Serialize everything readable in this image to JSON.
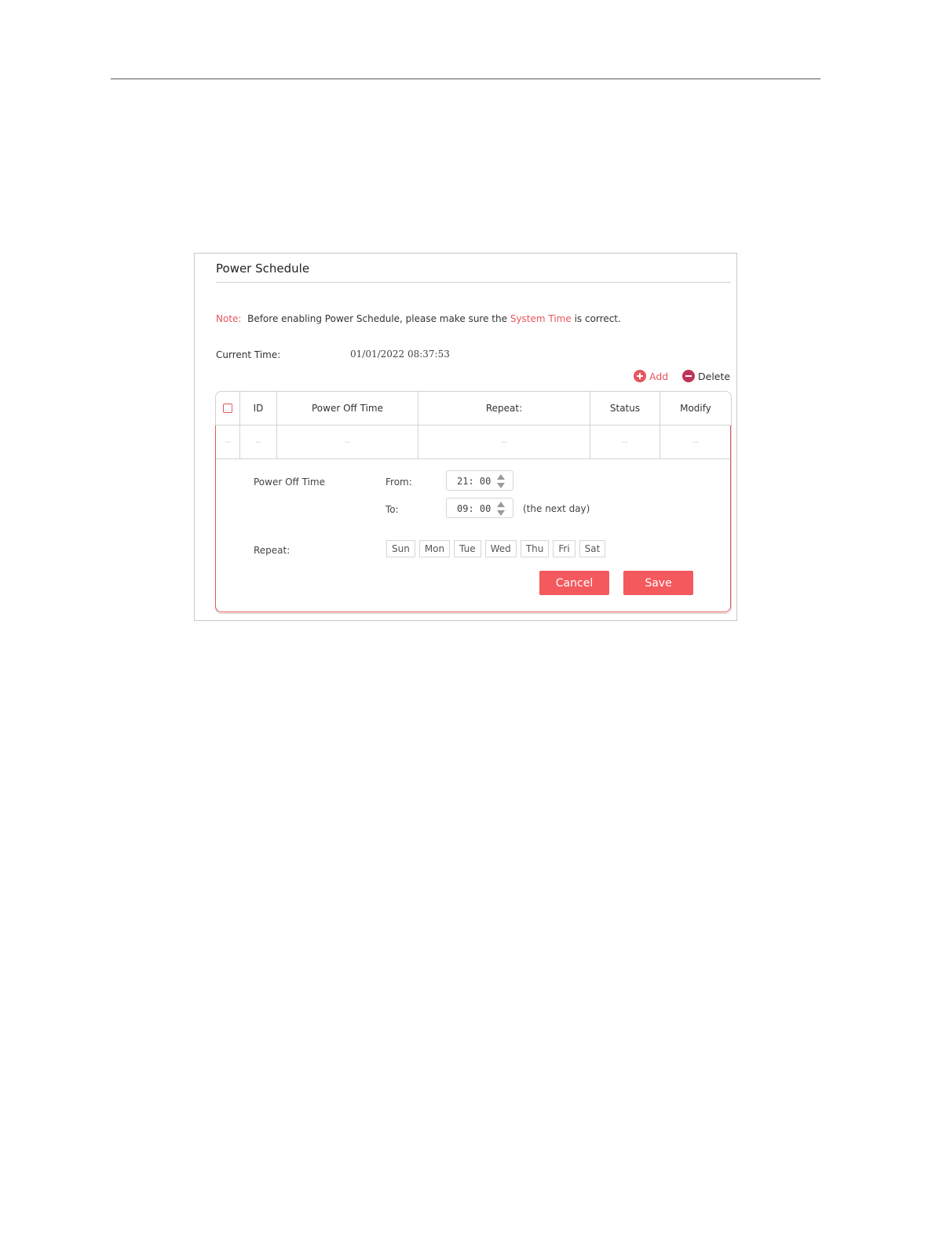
{
  "panel": {
    "title": "Power Schedule",
    "note_label": "Note:",
    "note_text_1": "Before enabling Power Schedule, please make sure the",
    "note_link": "System Time",
    "note_text_2": "is correct.",
    "current_time_label": "Current Time:",
    "current_time_value": "01/01/2022 08:37:53",
    "add_label": "Add",
    "delete_label": "Delete"
  },
  "table": {
    "headers": [
      "",
      "ID",
      "Power Off Time",
      "Repeat:",
      "Status",
      "Modify"
    ],
    "row": [
      "--",
      "--",
      "--",
      "--",
      "--",
      "--"
    ]
  },
  "form": {
    "power_off_time_label": "Power Off Time",
    "from_label": "From:",
    "from_value": "21: 00",
    "to_label": "To:",
    "to_value": "09: 00",
    "next_day_note": "(the next day)",
    "repeat_label": "Repeat:",
    "days": [
      "Sun",
      "Mon",
      "Tue",
      "Wed",
      "Thu",
      "Fri",
      "Sat"
    ],
    "cancel_label": "Cancel",
    "save_label": "Save"
  },
  "colors": {
    "accent": "#e8555c",
    "button": "#f4595e",
    "delete_icon": "#c0345a"
  }
}
